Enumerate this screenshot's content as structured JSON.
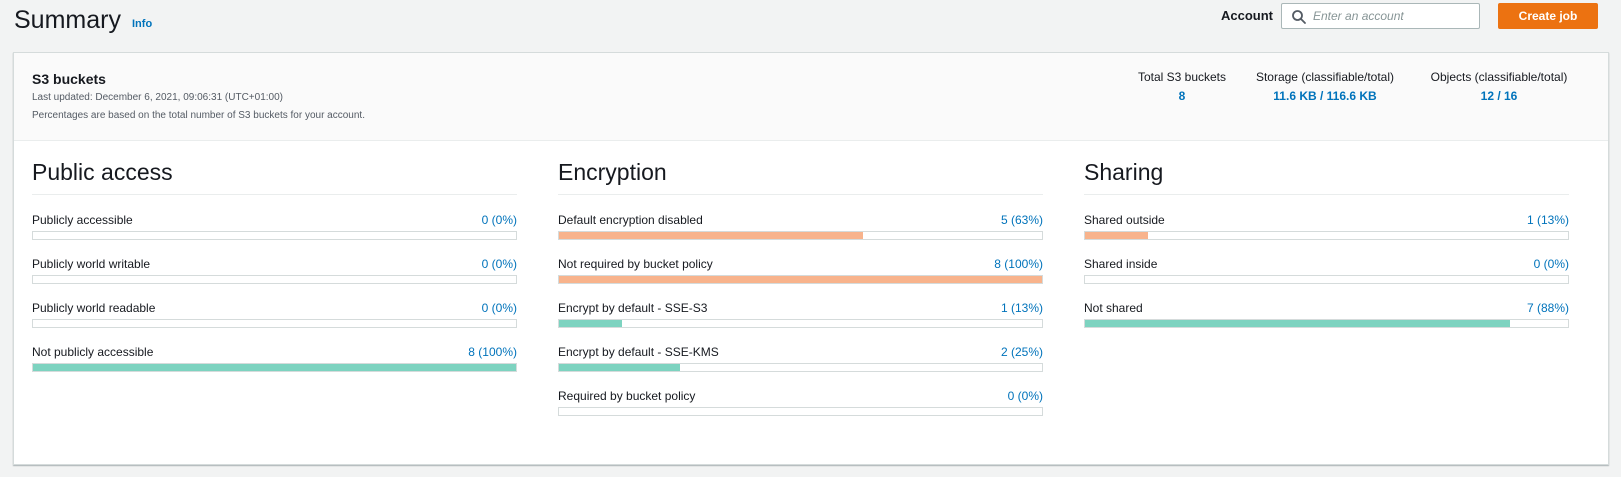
{
  "header": {
    "title": "Summary",
    "info": "Info",
    "account_label": "Account",
    "account_placeholder": "Enter an account",
    "create_job": "Create job"
  },
  "summary": {
    "title": "S3 buckets",
    "last_updated": "Last updated: December 6, 2021, 09:06:31 (UTC+01:00)",
    "note": "Percentages are based on the total number of S3 buckets for your account.",
    "stats": [
      {
        "label": "Total S3 buckets",
        "value": "8"
      },
      {
        "label": "Storage (classifiable/total)",
        "value": "11.6 KB / 116.6 KB"
      },
      {
        "label": "Objects (classifiable/total)",
        "value": "12 / 16"
      }
    ]
  },
  "colors": {
    "warning_fill": "#f8b38c",
    "ok_fill": "#7dd3c0",
    "link": "#0073bb",
    "primary_button": "#ec7211"
  },
  "sections": [
    {
      "title": "Public access",
      "metrics": [
        {
          "label": "Publicly accessible",
          "value": "0 (0%)",
          "fraction": 0,
          "color": "orange"
        },
        {
          "label": "Publicly world writable",
          "value": "0 (0%)",
          "fraction": 0,
          "color": "orange"
        },
        {
          "label": "Publicly world readable",
          "value": "0 (0%)",
          "fraction": 0,
          "color": "orange"
        },
        {
          "label": "Not publicly accessible",
          "value": "8 (100%)",
          "fraction": 1.0,
          "color": "teal"
        }
      ]
    },
    {
      "title": "Encryption",
      "metrics": [
        {
          "label": "Default encryption disabled",
          "value": "5 (63%)",
          "fraction": 0.63,
          "color": "orange"
        },
        {
          "label": "Not required by bucket policy",
          "value": "8 (100%)",
          "fraction": 1.0,
          "color": "orange"
        },
        {
          "label": "Encrypt by default - SSE-S3",
          "value": "1 (13%)",
          "fraction": 0.13,
          "color": "teal"
        },
        {
          "label": "Encrypt by default - SSE-KMS",
          "value": "2 (25%)",
          "fraction": 0.25,
          "color": "teal"
        },
        {
          "label": "Required by bucket policy",
          "value": "0 (0%)",
          "fraction": 0,
          "color": "teal"
        }
      ]
    },
    {
      "title": "Sharing",
      "metrics": [
        {
          "label": "Shared outside",
          "value": "1 (13%)",
          "fraction": 0.13,
          "color": "orange"
        },
        {
          "label": "Shared inside",
          "value": "0 (0%)",
          "fraction": 0,
          "color": "orange"
        },
        {
          "label": "Not shared",
          "value": "7 (88%)",
          "fraction": 0.88,
          "color": "teal"
        }
      ]
    }
  ]
}
